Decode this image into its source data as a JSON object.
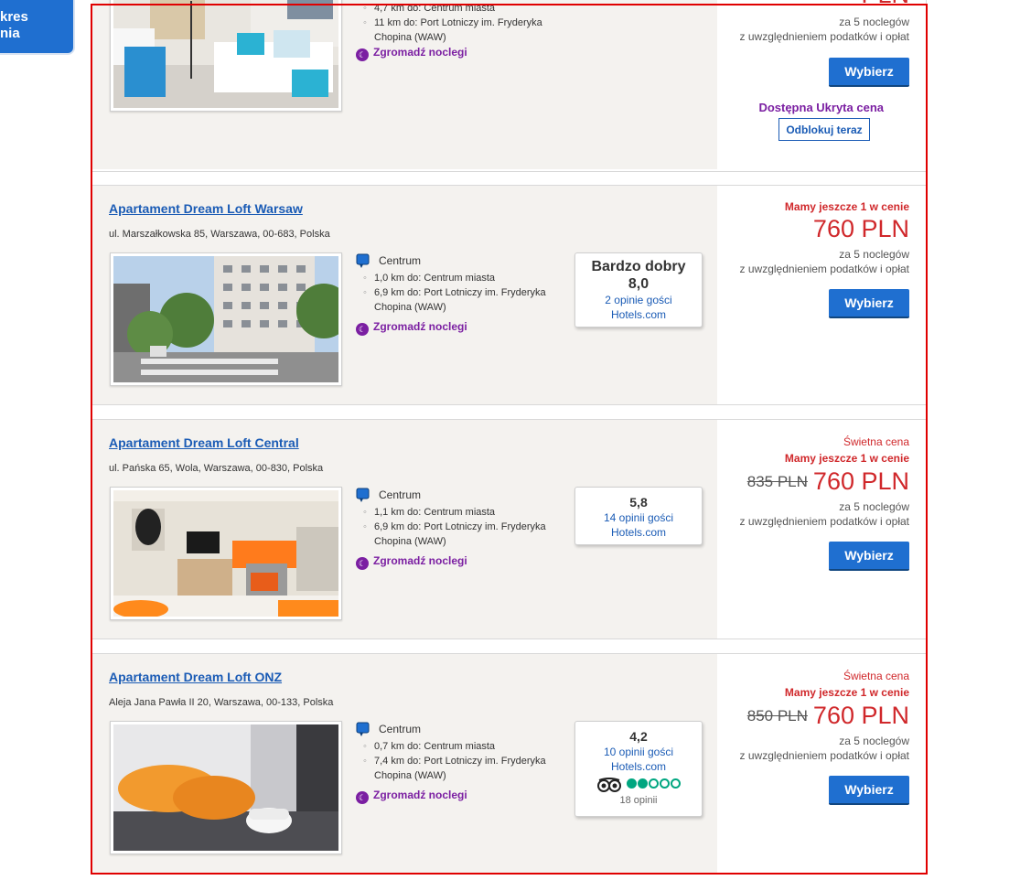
{
  "sidebar_button": {
    "line1": "kres",
    "line2": "nia"
  },
  "listing0": {
    "dist1": "4,7 km do: Centrum miasta",
    "dist2a": "11 km do: Port Lotniczy im. Fryderyka",
    "dist2b": "Chopina (WAW)",
    "reward": "Zgromadź noclegi",
    "price_partial": "PLN",
    "nights": "za 5 noclegów",
    "taxes": "z uwzględnieniem podatków i opłat",
    "select_label": "Wybierz",
    "hidden_price_label": "Dostępna Ukryta cena",
    "unlock_label": "Odblokuj teraz"
  },
  "listing1": {
    "title": "Apartament Dream Loft Warsaw",
    "address": "ul. Marszałkowska 85, Warszawa, 00-683, Polska",
    "location": "Centrum",
    "dist1": "1,0 km do: Centrum miasta",
    "dist2a": "6,9 km do: Port Lotniczy im. Fryderyka",
    "dist2b": "Chopina (WAW)",
    "reward": "Zgromadź noclegi",
    "review_grade": "Bardzo dobry",
    "review_score": "8,0",
    "review_count": "2 opinie gości",
    "review_source": "Hotels.com",
    "urgency": "Mamy jeszcze 1 w cenie",
    "price": "760 PLN",
    "nights": "za 5 noclegów",
    "taxes": "z uwzględnieniem podatków i opłat",
    "select_label": "Wybierz"
  },
  "listing2": {
    "title": "Apartament Dream Loft Central",
    "address": "ul. Pańska 65, Wola, Warszawa, 00-830, Polska",
    "location": "Centrum",
    "dist1": "1,1 km do: Centrum miasta",
    "dist2a": "6,9 km do: Port Lotniczy im. Fryderyka",
    "dist2b": "Chopina (WAW)",
    "reward": "Zgromadź noclegi",
    "review_score": "5,8",
    "review_count": "14 opinii gości",
    "review_source": "Hotels.com",
    "deal": "Świetna cena",
    "urgency": "Mamy jeszcze 1 w cenie",
    "old_price": "835 PLN",
    "price": "760 PLN",
    "nights": "za 5 noclegów",
    "taxes": "z uwzględnieniem podatków i opłat",
    "select_label": "Wybierz"
  },
  "listing3": {
    "title": "Apartament Dream Loft ONZ",
    "address": "Aleja Jana Pawła II 20, Warszawa, 00-133, Polska",
    "location": "Centrum",
    "dist1": "0,7 km do: Centrum miasta",
    "dist2a": "7,4 km do: Port Lotniczy im. Fryderyka",
    "dist2b": "Chopina (WAW)",
    "reward": "Zgromadź noclegi",
    "review_score": "4,2",
    "review_count": "10 opinii gości",
    "review_source": "Hotels.com",
    "tripadvisor_rating": 2,
    "tripadvisor_count": "18 opinii",
    "deal": "Świetna cena",
    "urgency": "Mamy jeszcze 1 w cenie",
    "old_price": "850 PLN",
    "price": "760 PLN",
    "nights": "za 5 noclegów",
    "taxes": "z uwzględnieniem podatków i opłat",
    "select_label": "Wybierz"
  },
  "colors": {
    "accent_blue": "#1f6fd0",
    "price_red": "#d0282b",
    "reward_purple": "#7b1fa2",
    "tripadvisor_green": "#00a680"
  }
}
